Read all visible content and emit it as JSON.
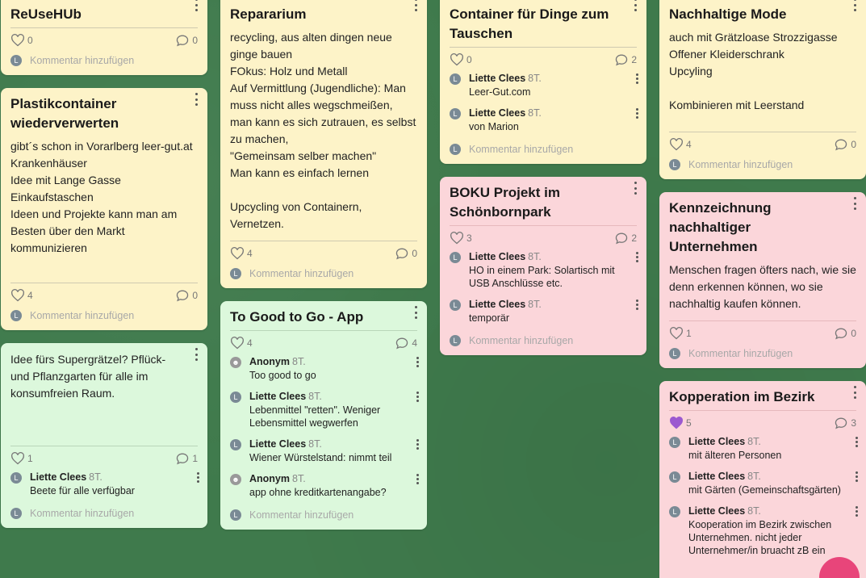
{
  "colors": {
    "background": "#3f7a4c",
    "yellow": "#fdf3c8",
    "green": "#dcf8dc",
    "pink": "#fbd6da",
    "liked_heart": "#9b59d0",
    "fab": "#e8457a"
  },
  "add_comment_placeholder": "Kommentar hinzufügen",
  "avatar_letter": "L",
  "col1": {
    "reusehub": {
      "title": "ReUseHUb",
      "likes": "0",
      "comments": "0"
    },
    "plastik": {
      "title": "Plastikcontainer wiederverwerten",
      "body": "gibt´s schon in Vorarlberg leer-gut.at\nKrankenhäuser\nIdee mit Lange Gasse\nEinkaufstaschen\nIdeen und Projekte kann man am Besten über den Markt kommunizieren",
      "likes": "4",
      "comments": "0"
    },
    "idee": {
      "body": "Idee fürs Supergrätzel? Pflück- und Pflanzgarten für alle im konsumfreien Raum.",
      "likes": "1",
      "comments": "1",
      "comment_list": [
        {
          "author": "Liette Clees",
          "time": "8T.",
          "text": "Beete für alle verfügbar"
        }
      ]
    }
  },
  "col2": {
    "repararium": {
      "title": "Repararium",
      "body": "recycling, aus alten dingen neue ginge bauen\nFOkus: Holz und Metall\nAuf Vermittlung (Jugendliche): Man muss nicht alles wegschmeißen, man kann es sich zutrauen, es selbst zu machen,\n\"Gemeinsam selber machen\"\nMan kann es einfach lernen\n\nUpcycling von Containern, Vernetzen.",
      "likes": "4",
      "comments": "0"
    },
    "togood": {
      "title": "To Good to Go - App",
      "likes": "4",
      "comments": "4",
      "comment_list": [
        {
          "author": "Anonym",
          "time": "8T.",
          "text": "Too good to go",
          "anon": true
        },
        {
          "author": "Liette Clees",
          "time": "8T.",
          "text": "Lebenmittel \"retten\". Weniger Lebensmittel wegwerfen",
          "anon": false
        },
        {
          "author": "Liette Clees",
          "time": "8T.",
          "text": "Wiener Würstelstand: nimmt teil",
          "anon": false
        },
        {
          "author": "Anonym",
          "time": "8T.",
          "text": "app ohne kreditkartenangabe?",
          "anon": true
        }
      ]
    }
  },
  "col3": {
    "container": {
      "title": "Container für Dinge zum Tauschen",
      "likes": "0",
      "comments": "2",
      "comment_list": [
        {
          "author": "Liette Clees",
          "time": "8T.",
          "text": "Leer-Gut.com"
        },
        {
          "author": "Liette Clees",
          "time": "8T.",
          "text": "von Marion"
        }
      ]
    },
    "boku": {
      "title": "BOKU Projekt im Schönbornpark",
      "likes": "3",
      "comments": "2",
      "comment_list": [
        {
          "author": "Liette Clees",
          "time": "8T.",
          "text": "HO in einem Park: Solartisch mit USB Anschlüsse etc."
        },
        {
          "author": "Liette Clees",
          "time": "8T.",
          "text": "temporär"
        }
      ]
    }
  },
  "col4": {
    "mode": {
      "title": "Nachhaltige Mode",
      "body": "auch mit Grätzloase Strozzigasse\nOffener Kleiderschrank\nUpcyling\n\nKombinieren mit Leerstand",
      "likes": "4",
      "comments": "0"
    },
    "kennz": {
      "title": "Kennzeichnung nachhaltiger Unternehmen",
      "body": "Menschen fragen öfters nach, wie sie denn erkennen können, wo sie nachhaltig kaufen können.",
      "likes": "1",
      "comments": "0"
    },
    "koop": {
      "title": "Kopperation im Bezirk",
      "likes": "5",
      "comments": "3",
      "comment_list": [
        {
          "author": "Liette Clees",
          "time": "8T.",
          "text": "mit älteren Personen"
        },
        {
          "author": "Liette Clees",
          "time": "8T.",
          "text": "mit Gärten (Gemeinschaftsgärten)"
        },
        {
          "author": "Liette Clees",
          "time": "8T.",
          "text": "Kooperation im Bezirk zwischen Unternehmen. nicht jeder Unternehmer/in bruacht zB ein"
        }
      ]
    }
  }
}
